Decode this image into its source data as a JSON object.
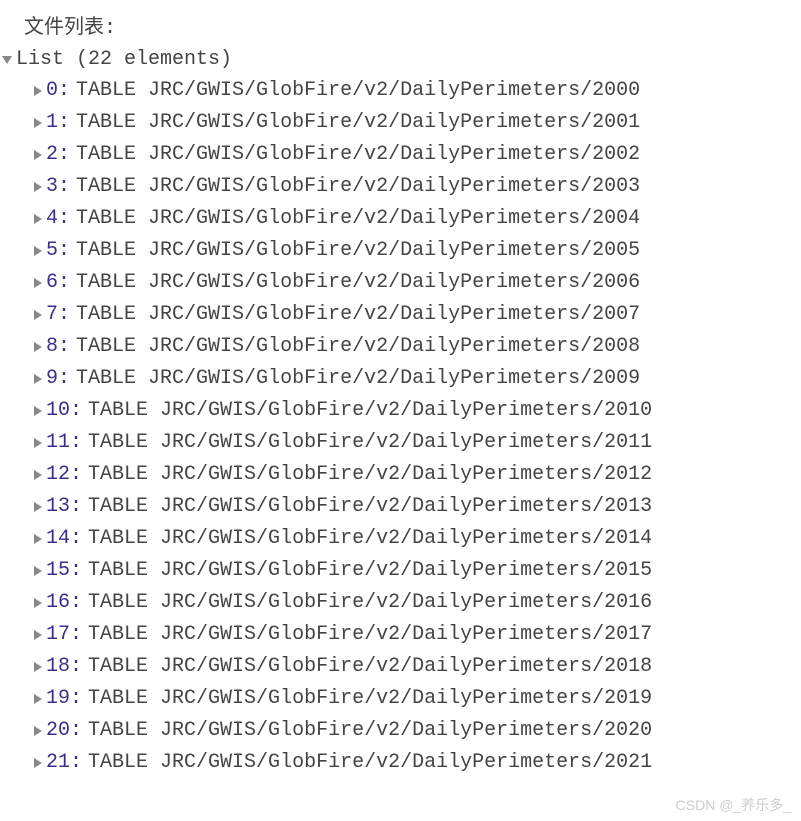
{
  "title": "文件列表:",
  "list": {
    "label": "List (22 elements)",
    "items": [
      {
        "index": "0",
        "value": "TABLE JRC/GWIS/GlobFire/v2/DailyPerimeters/2000"
      },
      {
        "index": "1",
        "value": "TABLE JRC/GWIS/GlobFire/v2/DailyPerimeters/2001"
      },
      {
        "index": "2",
        "value": "TABLE JRC/GWIS/GlobFire/v2/DailyPerimeters/2002"
      },
      {
        "index": "3",
        "value": "TABLE JRC/GWIS/GlobFire/v2/DailyPerimeters/2003"
      },
      {
        "index": "4",
        "value": "TABLE JRC/GWIS/GlobFire/v2/DailyPerimeters/2004"
      },
      {
        "index": "5",
        "value": "TABLE JRC/GWIS/GlobFire/v2/DailyPerimeters/2005"
      },
      {
        "index": "6",
        "value": "TABLE JRC/GWIS/GlobFire/v2/DailyPerimeters/2006"
      },
      {
        "index": "7",
        "value": "TABLE JRC/GWIS/GlobFire/v2/DailyPerimeters/2007"
      },
      {
        "index": "8",
        "value": "TABLE JRC/GWIS/GlobFire/v2/DailyPerimeters/2008"
      },
      {
        "index": "9",
        "value": "TABLE JRC/GWIS/GlobFire/v2/DailyPerimeters/2009"
      },
      {
        "index": "10",
        "value": "TABLE JRC/GWIS/GlobFire/v2/DailyPerimeters/2010"
      },
      {
        "index": "11",
        "value": "TABLE JRC/GWIS/GlobFire/v2/DailyPerimeters/2011"
      },
      {
        "index": "12",
        "value": "TABLE JRC/GWIS/GlobFire/v2/DailyPerimeters/2012"
      },
      {
        "index": "13",
        "value": "TABLE JRC/GWIS/GlobFire/v2/DailyPerimeters/2013"
      },
      {
        "index": "14",
        "value": "TABLE JRC/GWIS/GlobFire/v2/DailyPerimeters/2014"
      },
      {
        "index": "15",
        "value": "TABLE JRC/GWIS/GlobFire/v2/DailyPerimeters/2015"
      },
      {
        "index": "16",
        "value": "TABLE JRC/GWIS/GlobFire/v2/DailyPerimeters/2016"
      },
      {
        "index": "17",
        "value": "TABLE JRC/GWIS/GlobFire/v2/DailyPerimeters/2017"
      },
      {
        "index": "18",
        "value": "TABLE JRC/GWIS/GlobFire/v2/DailyPerimeters/2018"
      },
      {
        "index": "19",
        "value": "TABLE JRC/GWIS/GlobFire/v2/DailyPerimeters/2019"
      },
      {
        "index": "20",
        "value": "TABLE JRC/GWIS/GlobFire/v2/DailyPerimeters/2020"
      },
      {
        "index": "21",
        "value": "TABLE JRC/GWIS/GlobFire/v2/DailyPerimeters/2021"
      }
    ]
  },
  "watermark": "CSDN @_养乐多_"
}
